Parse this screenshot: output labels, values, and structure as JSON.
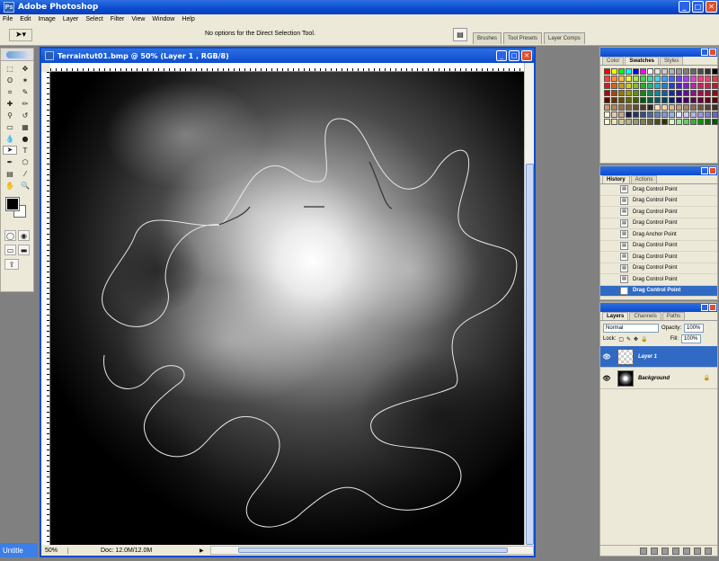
{
  "app": {
    "title": "Adobe Photoshop"
  },
  "menu": [
    "File",
    "Edit",
    "Image",
    "Layer",
    "Select",
    "Filter",
    "View",
    "Window",
    "Help"
  ],
  "options": {
    "text": "No options for the Direct Selection Tool."
  },
  "wells": [
    "Brushes",
    "Tool Presets",
    "Layer Comps"
  ],
  "document": {
    "title": "Terraintut01.bmp @ 50% (Layer 1 , RGB/8)",
    "zoom": "50%",
    "doc_info": "Doc: 12.0M/12.0M"
  },
  "color_panel": {
    "tabs": [
      "Color",
      "Swatches",
      "Styles"
    ],
    "active_tab": "Swatches",
    "swatches": [
      "#ff0000",
      "#ffff00",
      "#00ff00",
      "#00ffff",
      "#0000ff",
      "#ff00ff",
      "#ffffff",
      "#e6e6e6",
      "#cccccc",
      "#b3b3b3",
      "#999999",
      "#808080",
      "#666666",
      "#4d4d4d",
      "#333333",
      "#000000",
      "#ff4040",
      "#ff8c3f",
      "#ffbf40",
      "#f2f240",
      "#a6e640",
      "#40d940",
      "#40d9a6",
      "#40d9f2",
      "#409ff2",
      "#4066f2",
      "#6a40f2",
      "#a640f2",
      "#e640d9",
      "#f24080",
      "#f2407a",
      "#d94040",
      "#cc2020",
      "#cc6620",
      "#cc9920",
      "#cccc20",
      "#80bf20",
      "#20b320",
      "#20b380",
      "#20b3cc",
      "#2080cc",
      "#2040cc",
      "#5020cc",
      "#8020cc",
      "#bf20b3",
      "#cc2066",
      "#cc2055",
      "#b32020",
      "#991010",
      "#994d10",
      "#997310",
      "#999910",
      "#5f8f10",
      "#108610",
      "#10865f",
      "#108699",
      "#105f99",
      "#103099",
      "#3c1099",
      "#5f1099",
      "#8f1086",
      "#99104d",
      "#991040",
      "#861010",
      "#660000",
      "#663300",
      "#664d00",
      "#666600",
      "#405f00",
      "#005900",
      "#005940",
      "#005966",
      "#004066",
      "#002066",
      "#280066",
      "#400066",
      "#5f0059",
      "#660033",
      "#66002a",
      "#590000",
      "#cc9966",
      "#b38659",
      "#99734d",
      "#806040",
      "#664d33",
      "#4d3926",
      "#33261a",
      "#ffe0c0",
      "#f2d2b0",
      "#d9b896",
      "#bf9f7f",
      "#a68569",
      "#8c6c55",
      "#735742",
      "#594230",
      "#40301f",
      "#fff0e0",
      "#e0c8b0",
      "#c8a888",
      "#1a1a40",
      "#263366",
      "#334d80",
      "#4d6699",
      "#6680b3",
      "#8099cc",
      "#99b3e6",
      "#e6e6ff",
      "#ccccf2",
      "#b3b3e6",
      "#9999d9",
      "#8080cc",
      "#6666bf",
      "#ffffcc",
      "#e6e6b3",
      "#cccc99",
      "#b3b380",
      "#999966",
      "#80804d",
      "#666633",
      "#4d4d1a",
      "#333300",
      "#ccffcc",
      "#99e699",
      "#66cc66",
      "#33b333",
      "#009900",
      "#007700",
      "#005500"
    ]
  },
  "history_panel": {
    "tabs": [
      "History",
      "Actions"
    ],
    "active_tab": "History",
    "items": [
      "Drag Control Point",
      "Drag Control Point",
      "Drag Control Point",
      "Drag Control Point",
      "Drag Anchor Point",
      "Drag Control Point",
      "Drag Control Point",
      "Drag Control Point",
      "Drag Control Point",
      "Drag Control Point"
    ],
    "current_index": 9
  },
  "layers_panel": {
    "tabs": [
      "Layers",
      "Channels",
      "Paths"
    ],
    "active_tab": "Layers",
    "blend_mode": "Normal",
    "opacity_label": "Opacity:",
    "opacity": "100%",
    "lock_label": "Lock:",
    "fill_label": "Fill:",
    "fill": "100%",
    "layers": [
      {
        "name": "Layer 1",
        "active": true
      },
      {
        "name": "Background",
        "active": false
      }
    ]
  },
  "taskbar": {
    "label": "Untitle"
  }
}
